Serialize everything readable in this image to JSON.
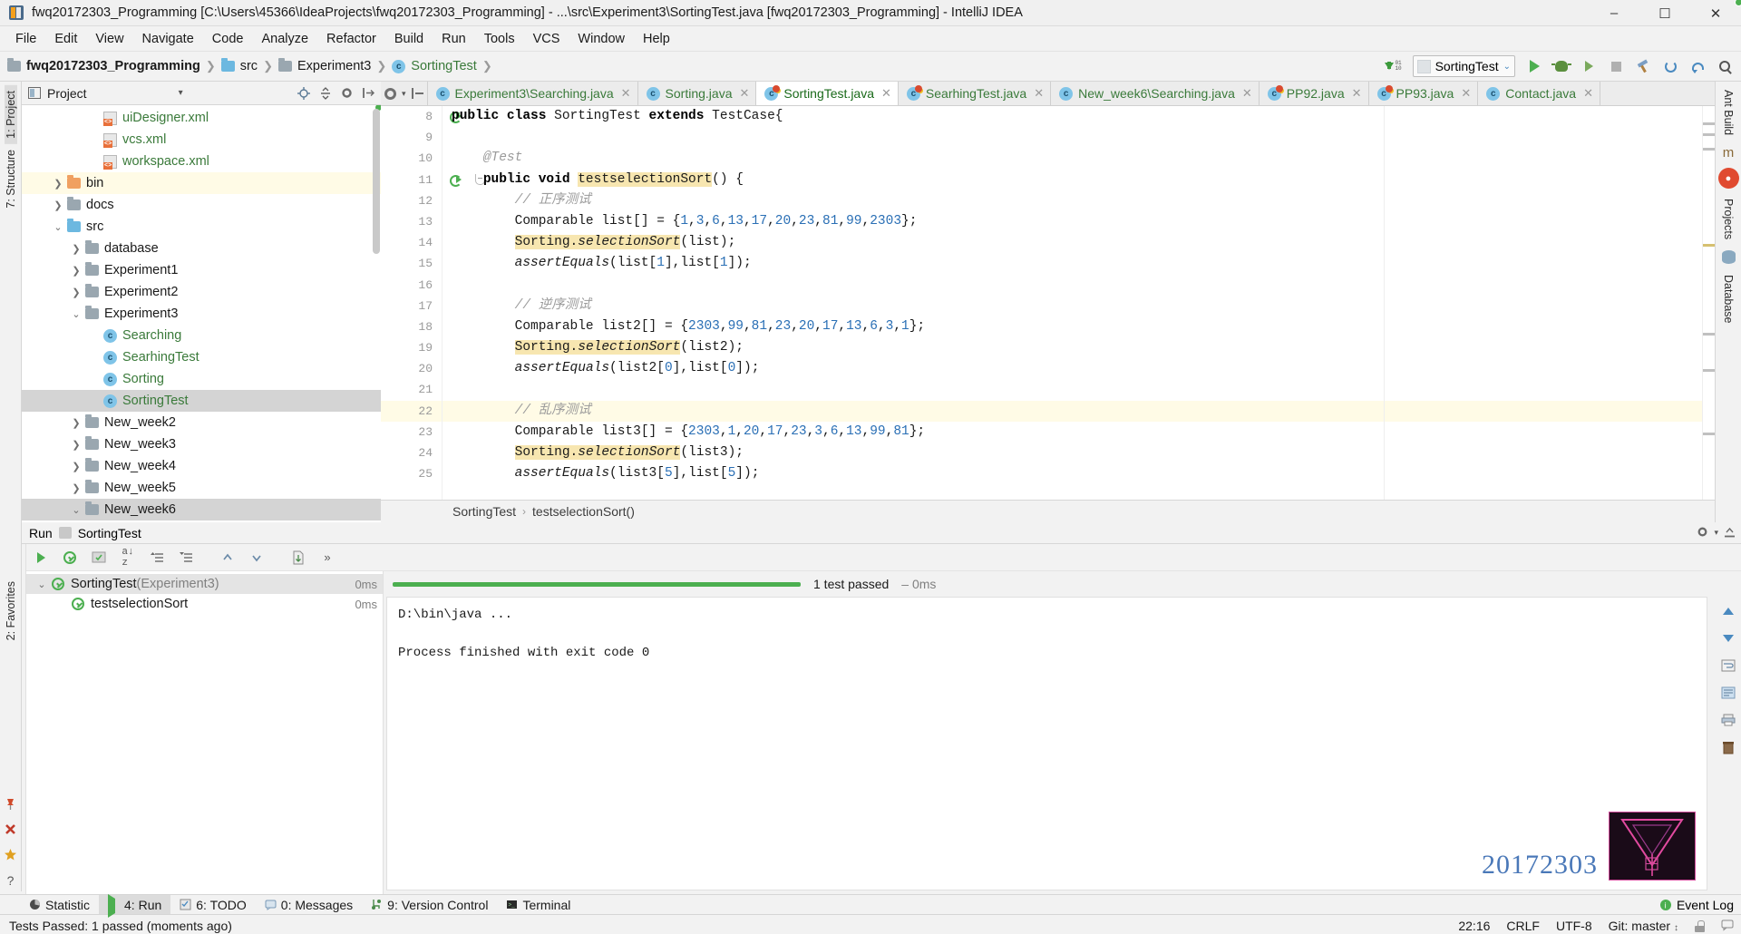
{
  "window": {
    "title": "fwq20172303_Programming [C:\\Users\\45366\\IdeaProjects\\fwq20172303_Programming] - ...\\src\\Experiment3\\SortingTest.java [fwq20172303_Programming] - IntelliJ IDEA",
    "minimize": "–",
    "maximize": "☐",
    "close": "✕",
    "app_icon": "intellij-idea-icon"
  },
  "menubar": {
    "items": [
      {
        "label": "File"
      },
      {
        "label": "Edit"
      },
      {
        "label": "View"
      },
      {
        "label": "Navigate"
      },
      {
        "label": "Code"
      },
      {
        "label": "Analyze"
      },
      {
        "label": "Refactor"
      },
      {
        "label": "Build"
      },
      {
        "label": "Run"
      },
      {
        "label": "Tools"
      },
      {
        "label": "VCS"
      },
      {
        "label": "Window"
      },
      {
        "label": "Help"
      }
    ]
  },
  "navbar": {
    "breadcrumbs": [
      {
        "label": "fwq20172303_Programming",
        "icon": "folder-icon",
        "style": "bold"
      },
      {
        "label": "src",
        "icon": "folder-blue-icon",
        "style": "normal"
      },
      {
        "label": "Experiment3",
        "icon": "folder-icon",
        "style": "normal"
      },
      {
        "label": "SortingTest",
        "icon": "test-class-icon",
        "style": "green"
      }
    ],
    "separator": "❯",
    "download_icon": "download-dependencies-icon",
    "bin_digits": "01\n10",
    "run_config": {
      "label": "SortingTest",
      "icon": "run-config-icon",
      "caret": "⌄"
    },
    "buttons": [
      {
        "name": "run-button",
        "icon": "play-icon"
      },
      {
        "name": "debug-button",
        "icon": "bug-icon"
      },
      {
        "name": "run-coverage-button",
        "icon": "coverage-icon"
      },
      {
        "name": "stop-button",
        "icon": "stop-icon"
      },
      {
        "name": "build-button",
        "icon": "hammer-icon"
      },
      {
        "name": "sync-button",
        "icon": "refresh-icon"
      },
      {
        "name": "undo-button",
        "icon": "undo-icon"
      },
      {
        "name": "search-everywhere-button",
        "icon": "magnifier-icon"
      }
    ]
  },
  "left_strip": {
    "items": [
      {
        "label": "1: Project",
        "selected": true
      },
      {
        "label": "7: Structure",
        "selected": false
      }
    ],
    "bottom_items": [
      {
        "label": "2: Favorites",
        "selected": false
      }
    ],
    "bottom_icons": [
      "pin-icon",
      "close-red-icon",
      "star-icon",
      "help-icon"
    ]
  },
  "project_panel": {
    "title": "Project",
    "caret": "▾",
    "header_icons": [
      "target-icon",
      "collapse-all-icon",
      "settings-icon",
      "hide-icon"
    ],
    "tree": [
      {
        "indent": 3,
        "twisty": "",
        "icon": "xml-file-icon",
        "label": "uiDesigner.xml",
        "color": "green",
        "state": ""
      },
      {
        "indent": 3,
        "twisty": "",
        "icon": "xml-file-icon",
        "label": "vcs.xml",
        "color": "green",
        "state": ""
      },
      {
        "indent": 3,
        "twisty": "",
        "icon": "xml-file-icon",
        "label": "workspace.xml",
        "color": "green",
        "state": ""
      },
      {
        "indent": 1,
        "twisty": "❯",
        "icon": "folder-orange-icon",
        "label": "bin",
        "color": "plain",
        "state": "hl-yellow"
      },
      {
        "indent": 1,
        "twisty": "❯",
        "icon": "folder-icon",
        "label": "docs",
        "color": "plain",
        "state": ""
      },
      {
        "indent": 1,
        "twisty": "⌄",
        "icon": "folder-blue-icon",
        "label": "src",
        "color": "plain",
        "state": ""
      },
      {
        "indent": 2,
        "twisty": "❯",
        "icon": "folder-icon",
        "label": "database",
        "color": "plain",
        "state": ""
      },
      {
        "indent": 2,
        "twisty": "❯",
        "icon": "folder-icon",
        "label": "Experiment1",
        "color": "plain",
        "state": ""
      },
      {
        "indent": 2,
        "twisty": "❯",
        "icon": "folder-icon",
        "label": "Experiment2",
        "color": "plain",
        "state": ""
      },
      {
        "indent": 2,
        "twisty": "⌄",
        "icon": "folder-icon",
        "label": "Experiment3",
        "color": "plain",
        "state": ""
      },
      {
        "indent": 3,
        "twisty": "",
        "icon": "class-icon",
        "label": "Searching",
        "color": "green",
        "state": ""
      },
      {
        "indent": 3,
        "twisty": "",
        "icon": "test-class-icon",
        "label": "SearhingTest",
        "color": "green",
        "state": ""
      },
      {
        "indent": 3,
        "twisty": "",
        "icon": "class-icon",
        "label": "Sorting",
        "color": "green",
        "state": ""
      },
      {
        "indent": 3,
        "twisty": "",
        "icon": "test-class-icon",
        "label": "SortingTest",
        "color": "green",
        "state": "sel"
      },
      {
        "indent": 2,
        "twisty": "❯",
        "icon": "folder-icon",
        "label": "New_week2",
        "color": "plain",
        "state": ""
      },
      {
        "indent": 2,
        "twisty": "❯",
        "icon": "folder-icon",
        "label": "New_week3",
        "color": "plain",
        "state": ""
      },
      {
        "indent": 2,
        "twisty": "❯",
        "icon": "folder-icon",
        "label": "New_week4",
        "color": "plain",
        "state": ""
      },
      {
        "indent": 2,
        "twisty": "❯",
        "icon": "folder-icon",
        "label": "New_week5",
        "color": "plain",
        "state": ""
      },
      {
        "indent": 2,
        "twisty": "⌄",
        "icon": "folder-icon",
        "label": "New_week6",
        "color": "plain",
        "state": "sel"
      }
    ]
  },
  "editor": {
    "tab_tools": [
      "settings-gear-icon",
      "collapse-icon"
    ],
    "tabs": [
      {
        "label": "Experiment3\\Searching.java",
        "icon": "class-icon",
        "active": false,
        "close": "✕"
      },
      {
        "label": "Sorting.java",
        "icon": "class-icon",
        "active": false,
        "close": "✕"
      },
      {
        "label": "SortingTest.java",
        "icon": "test-class-icon",
        "active": true,
        "close": "✕"
      },
      {
        "label": "SearhingTest.java",
        "icon": "test-class-icon",
        "active": false,
        "close": "✕"
      },
      {
        "label": "New_week6\\Searching.java",
        "icon": "class-icon",
        "active": false,
        "close": "✕"
      },
      {
        "label": "PP92.java",
        "icon": "test-class-icon",
        "active": false,
        "close": "✕"
      },
      {
        "label": "PP93.java",
        "icon": "test-class-icon",
        "active": false,
        "close": "✕"
      },
      {
        "label": "Contact.java",
        "icon": "class-icon",
        "active": false,
        "close": "✕"
      }
    ],
    "lines": [
      {
        "no": "8",
        "mark": "run",
        "html": "<span class=\"k\">public class</span> SortingTest <span class=\"k\">extends</span> TestCase{",
        "hl": false
      },
      {
        "no": "9",
        "mark": "",
        "html": "",
        "hl": false
      },
      {
        "no": "10",
        "mark": "",
        "html": "    <span class=\"cmt\">@Test</span>",
        "hl": false
      },
      {
        "no": "11",
        "mark": "run",
        "fold": true,
        "html": "    <span class=\"k\">public void</span> <span class=\"hlw\">testselectionSort</span>() {",
        "hl": false
      },
      {
        "no": "12",
        "mark": "",
        "html": "        <span class=\"cmt\">// 正序测试</span>",
        "hl": false
      },
      {
        "no": "13",
        "mark": "",
        "html": "        Comparable list[] = {<span class=\"num\">1</span>,<span class=\"num\">3</span>,<span class=\"num\">6</span>,<span class=\"num\">13</span>,<span class=\"num\">17</span>,<span class=\"num\">20</span>,<span class=\"num\">23</span>,<span class=\"num\">81</span>,<span class=\"num\">99</span>,<span class=\"num\">2303</span>};",
        "hl": false
      },
      {
        "no": "14",
        "mark": "",
        "html": "        <span class=\"hlw\">Sorting.<span class=\"it\">selectionSort</span></span>(list);",
        "hl": false
      },
      {
        "no": "15",
        "mark": "",
        "html": "        <span class=\"it\">assertEquals</span>(list[<span class=\"num\">1</span>],list[<span class=\"num\">1</span>]);",
        "hl": false
      },
      {
        "no": "16",
        "mark": "",
        "html": "",
        "hl": false
      },
      {
        "no": "17",
        "mark": "",
        "html": "        <span class=\"cmt\">// 逆序测试</span>",
        "hl": false
      },
      {
        "no": "18",
        "mark": "",
        "html": "        Comparable list2[] = {<span class=\"num\">2303</span>,<span class=\"num\">99</span>,<span class=\"num\">81</span>,<span class=\"num\">23</span>,<span class=\"num\">20</span>,<span class=\"num\">17</span>,<span class=\"num\">13</span>,<span class=\"num\">6</span>,<span class=\"num\">3</span>,<span class=\"num\">1</span>};",
        "hl": false
      },
      {
        "no": "19",
        "mark": "",
        "html": "        <span class=\"hlw\">Sorting.<span class=\"it\">selectionSort</span></span>(list2);",
        "hl": false
      },
      {
        "no": "20",
        "mark": "",
        "html": "        <span class=\"it\">assertEquals</span>(list2[<span class=\"num\">0</span>],list[<span class=\"num\">0</span>]);",
        "hl": false
      },
      {
        "no": "21",
        "mark": "",
        "html": "",
        "hl": false
      },
      {
        "no": "22",
        "mark": "bulb",
        "html": "        <span class=\"cmt\">// 乱序测试</span>",
        "hl": true
      },
      {
        "no": "23",
        "mark": "",
        "html": "        Comparable list3[] = {<span class=\"num\">2303</span>,<span class=\"num\">1</span>,<span class=\"num\">20</span>,<span class=\"num\">17</span>,<span class=\"num\">23</span>,<span class=\"num\">3</span>,<span class=\"num\">6</span>,<span class=\"num\">13</span>,<span class=\"num\">99</span>,<span class=\"num\">81</span>};",
        "hl": false
      },
      {
        "no": "24",
        "mark": "",
        "html": "        <span class=\"hlw\">Sorting.<span class=\"it\">selectionSort</span></span>(list3);",
        "hl": false
      },
      {
        "no": "25",
        "mark": "",
        "html": "        <span class=\"it\">assertEquals</span>(list3[<span class=\"num\">5</span>],list[<span class=\"num\">5</span>]);",
        "hl": false
      }
    ],
    "breadcrumb": {
      "class": "SortingTest",
      "separator": "›",
      "method": "testselectionSort()"
    }
  },
  "right_strip": {
    "labels": [
      {
        "label": "Ant Build"
      },
      {
        "label": "Projects"
      },
      {
        "label": "Database"
      }
    ],
    "badge": "●",
    "maven_glyph": "m"
  },
  "run_window": {
    "title": "Run",
    "config_name": "SortingTest",
    "header_icons": [
      "settings-icon",
      "hide-window-icon"
    ],
    "toolbar_left": [
      "rerun-icon",
      "rerun-failed-icon",
      "stop-icon",
      "export-icon",
      "print-icon",
      "import-icon",
      "layout-icon"
    ],
    "test_toolbar": [
      "rerun-tests-icon",
      "toggle-passed-icon",
      "sort-alphabetically-icon",
      "expand-all-icon",
      "collapse-all-icon",
      "prev-failed-icon",
      "next-failed-icon",
      "export-results-icon",
      "more-icon"
    ],
    "progress": {
      "bar_color": "#4caf50",
      "status": "1 test passed",
      "time": "– 0ms"
    },
    "tree": [
      {
        "indent": 0,
        "twisty": "⌄",
        "label": "SortingTest",
        "suffix": " (Experiment3)",
        "time": "0ms",
        "selected": true
      },
      {
        "indent": 1,
        "twisty": "",
        "label": "testselectionSort",
        "suffix": "",
        "time": "0ms",
        "selected": false
      }
    ],
    "console": [
      "D:\\bin\\java ...",
      "",
      "Process finished with exit code 0"
    ],
    "console_side_icons": [
      "scroll-up-icon",
      "scroll-down-icon",
      "soft-wrap-icon",
      "scroll-end-icon",
      "print-icon",
      "clear-all-icon"
    ],
    "watermark": {
      "number": "20172303",
      "logo": "triangle-logo"
    }
  },
  "bottom_tabs": {
    "items": [
      {
        "label": "Statistic",
        "mnemonic": "",
        "icon": "statistic-icon",
        "active": false
      },
      {
        "label": "4: Run",
        "mnemonic": "4",
        "icon": "play-small-icon",
        "active": true
      },
      {
        "label": "6: TODO",
        "mnemonic": "6",
        "icon": "todo-icon",
        "active": false
      },
      {
        "label": "0: Messages",
        "mnemonic": "0",
        "icon": "messages-icon",
        "active": false
      },
      {
        "label": "9: Version Control",
        "mnemonic": "9",
        "icon": "vcs-icon",
        "active": false
      },
      {
        "label": "Terminal",
        "mnemonic": "",
        "icon": "terminal-icon",
        "active": false
      }
    ],
    "event_log": {
      "label": "Event Log",
      "icon": "event-log-icon"
    }
  },
  "statusbar": {
    "message": "Tests Passed: 1 passed (moments ago)",
    "time": "22:16",
    "line_separator": "CRLF",
    "encoding": "UTF-8",
    "branch": "Git: master",
    "branch_caret": "↕",
    "lock_icon": "lock-icon",
    "balloon_icon": "balloon-icon"
  },
  "colors": {
    "accent_green": "#4caf50",
    "link_blue": "#4a8ac0",
    "highlight_yellow": "#fffbe6",
    "code_highlight": "#f7e6b0",
    "watermark_blue": "#4a78b8"
  }
}
